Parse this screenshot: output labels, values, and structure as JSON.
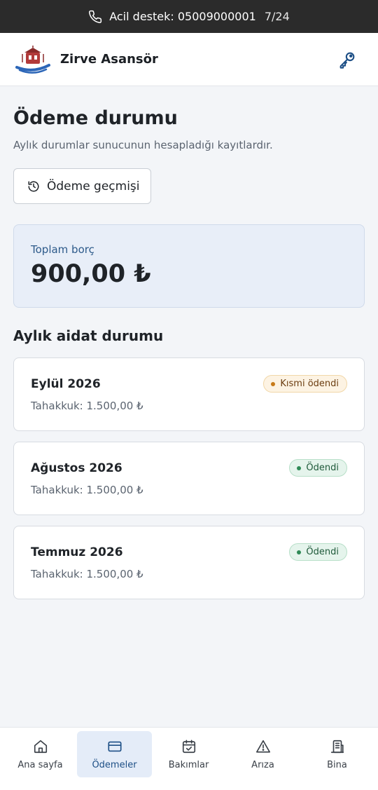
{
  "topbar": {
    "support_text": "Acil destek: 05009000001",
    "counter": "7/24"
  },
  "header": {
    "brand": "Zirve Asansör"
  },
  "page": {
    "title": "Ödeme durumu",
    "subtitle": "Aylık durumlar sunucunun hesapladığı kayıtlardır.",
    "history_button": "Ödeme geçmişi"
  },
  "debt": {
    "label": "Toplam borç",
    "value": "900,00 ₺"
  },
  "section": {
    "title": "Aylık aidat durumu"
  },
  "months": [
    {
      "name": "Eylül 2026",
      "accrual": "Tahakkuk: 1.500,00 ₺",
      "status": "Kısmi ödendi",
      "status_type": "partial"
    },
    {
      "name": "Ağustos 2026",
      "accrual": "Tahakkuk: 1.500,00 ₺",
      "status": "Ödendi",
      "status_type": "paid"
    },
    {
      "name": "Temmuz 2026",
      "accrual": "Tahakkuk: 1.500,00 ₺",
      "status": "Ödendi",
      "status_type": "paid"
    }
  ],
  "nav": [
    {
      "label": "Ana sayfa",
      "icon": "home-icon",
      "active": false
    },
    {
      "label": "Ödemeler",
      "icon": "credit-card-icon",
      "active": true
    },
    {
      "label": "Bakımlar",
      "icon": "calendar-check-icon",
      "active": false
    },
    {
      "label": "Arıza",
      "icon": "warning-triangle-icon",
      "active": false
    },
    {
      "label": "Bina",
      "icon": "building-icon",
      "active": false
    }
  ],
  "colors": {
    "topbar_bg": "#2b2b2b",
    "accent": "#1d4f86",
    "partial_badge": "#fdf3e3",
    "paid_badge": "#e5f4ec"
  }
}
